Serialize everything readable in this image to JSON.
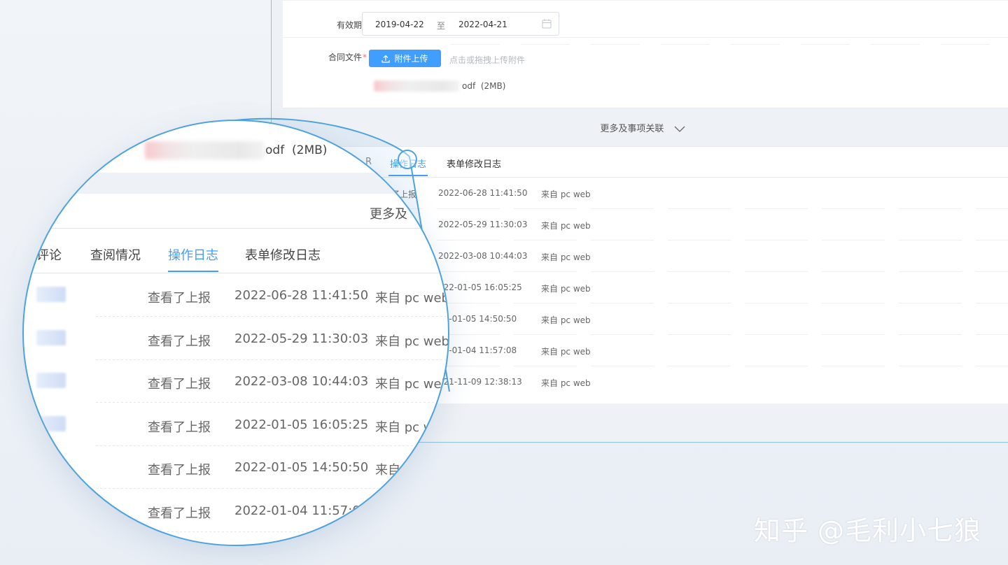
{
  "form": {
    "validity": {
      "label": "有效期",
      "required_mark": "*",
      "start": "2019-04-22",
      "separator": "至",
      "end": "2022-04-21"
    },
    "contract": {
      "label": "合同文件",
      "required_mark": "*",
      "upload_button": "附件上传",
      "upload_tip": "点击或拖拽上传附件",
      "file_suffix": "odf",
      "file_size": "(2MB)"
    }
  },
  "more_toggle": "更多及事项关联",
  "tabs": {
    "hidden_partial": "R",
    "active": "操作日志",
    "form_log": "表单修改日志"
  },
  "logs": [
    {
      "action": "了上报",
      "time": "2022-06-28 11:41:50",
      "source": "来自 pc web"
    },
    {
      "action": "",
      "time": "2022-05-29 11:30:03",
      "source": "来自 pc web"
    },
    {
      "action": "",
      "time": "2022-03-08 10:44:03",
      "source": "来自 pc web"
    },
    {
      "action": "",
      "time": "022-01-05 16:05:25",
      "source": "来自 pc web"
    },
    {
      "action": "",
      "time": "22-01-05 14:50:50",
      "source": "来自 pc web"
    },
    {
      "action": "",
      "time": "22-01-04 11:57:08",
      "source": "来自 pc web"
    },
    {
      "action": "",
      "time": "021-11-09 12:38:13",
      "source": "来自 pc web"
    }
  ],
  "magnifier": {
    "file_suffix": "odf",
    "file_size": "(2MB)",
    "more_partial": "更多及",
    "tabs": [
      "评论",
      "查阅情况",
      "操作日志",
      "表单修改日志"
    ],
    "rows": [
      {
        "action": "查看了上报",
        "time": "2022-06-28 11:41:50",
        "source": "来自 pc web"
      },
      {
        "action": "查看了上报",
        "time": "2022-05-29 11:30:03",
        "source": "来自 pc web"
      },
      {
        "action": "查看了上报",
        "time": "2022-03-08 10:44:03",
        "source": "来自 pc web"
      },
      {
        "action": "查看了上报",
        "time": "2022-01-05 16:05:25",
        "source": "来自 pc w"
      },
      {
        "action": "查看了上报",
        "time": "2022-01-05 14:50:50",
        "source": "来自"
      },
      {
        "action": "查看了上报",
        "time": "2022-01-04 11:57:08",
        "source": ""
      }
    ]
  },
  "watermark": "知乎 @毛利小七狼",
  "colors": {
    "accent": "#409eff",
    "required": "#f56c6c",
    "magnifier_ring": "#4ea3dd"
  },
  "icons": {
    "upload": "upload-icon",
    "calendar": "calendar-icon",
    "chevron": "chevron-down-icon"
  }
}
